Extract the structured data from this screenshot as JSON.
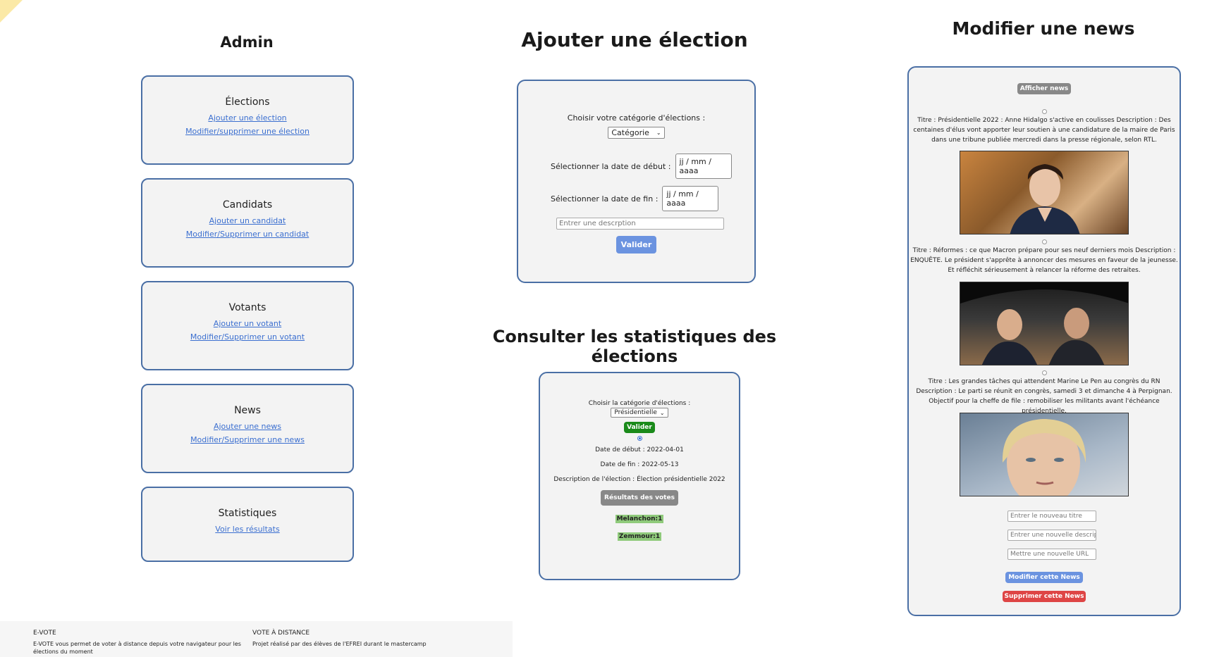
{
  "admin": {
    "title": "Admin",
    "cards": [
      {
        "title": "Élections",
        "links": [
          "Ajouter une élection",
          "Modifier/supprimer une élection"
        ]
      },
      {
        "title": "Candidats",
        "links": [
          "Ajouter un candidat",
          "Modifier/Supprimer un candidat"
        ]
      },
      {
        "title": "Votants",
        "links": [
          "Ajouter un votant",
          "Modifier/Supprimer un votant"
        ]
      },
      {
        "title": "News",
        "links": [
          "Ajouter une news",
          "Modifier/Supprimer une news"
        ]
      },
      {
        "title": "Statistiques",
        "links": [
          "Voir les résultats"
        ]
      }
    ]
  },
  "add_election": {
    "title": "Ajouter une élection",
    "category_label": "Choisir votre catégorie d'élections :",
    "category_value": "Catégorie",
    "start_label": "Sélectionner la date de début :",
    "start_placeholder": "jj / mm / aaaa",
    "end_label": "Sélectionner la date de fin :",
    "end_placeholder": "jj / mm / aaaa",
    "description_placeholder": "Entrer une descrption",
    "submit_label": "Valider"
  },
  "stats": {
    "title": "Consulter les statistiques des élections",
    "category_label": "Choisir la catégorie d'élections :",
    "category_value": "Présidentielle",
    "submit_label": "Valider",
    "start_date": "Date de début : 2022-04-01",
    "end_date": "Date de fin : 2022-05-13",
    "description": "Description de l'élection : Élection présidentielle 2022",
    "results_button": "Résultats des votes",
    "results": [
      "Melanchon:1",
      "Zemmour:1"
    ]
  },
  "news": {
    "title": "Modifier une news",
    "show_button": "Afficher news",
    "items": [
      "Titre : Présidentielle 2022 : Anne Hidalgo s'active en coulisses Description : Des centaines d'élus vont apporter leur soutien à une candidature de la maire de Paris dans une tribune publiée mercredi dans la presse régionale, selon RTL.",
      "Titre : Réformes : ce que Macron prépare pour ses neuf derniers mois Description : ENQUÊTE. Le président s'apprête à annoncer des mesures en faveur de la jeunesse. Et réfléchit sérieusement à relancer la réforme des retraites.",
      "Titre : Les grandes tâches qui attendent Marine Le Pen au congrès du RN Description : Le parti se réunit en congrès, samedi 3 et dimanche 4 à Perpignan. Objectif pour la cheffe de file : remobiliser les militants avant l'échéance présidentielle."
    ],
    "title_placeholder": "Entrer le nouveau titre",
    "description_placeholder": "Entrer une nouvelle descriptio",
    "url_placeholder": "Mettre une nouvelle URL",
    "modify_button": "Modifier cette News",
    "delete_button": "Supprimer cette News"
  },
  "footer": {
    "col1_title": "E-VOTE",
    "col1_text": "E-VOTE vous permet de voter à distance depuis votre navigateur pour les élections du moment",
    "col2_title": "VOTE À DISTANCE",
    "col2_text": "Projet réalisé par des élèves de l'EFREI durant le mastercamp"
  },
  "colors": {
    "border": "#4a6fa5",
    "link": "#3b6fd0",
    "valider_green": "#1a8a1a",
    "modify_blue": "#6b93e0",
    "delete_red": "#de4545",
    "result_green": "#8fca7b"
  }
}
